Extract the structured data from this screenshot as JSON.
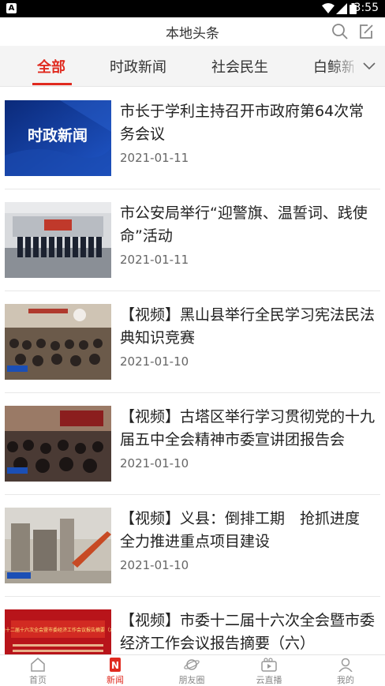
{
  "status": {
    "time": "3:55",
    "app_icon": "A"
  },
  "header": {
    "title": "本地头条",
    "search_icon": "search-icon",
    "edit_icon": "edit-icon"
  },
  "tabs": [
    {
      "label": "全部",
      "active": true
    },
    {
      "label": "时政新闻",
      "active": false
    },
    {
      "label": "社会民生",
      "active": false
    },
    {
      "label": "白鲸新",
      "active": false
    }
  ],
  "thumb_texts": {
    "politics": "时政新闻",
    "report_banner": "市委十二届十六次全会暨市委经济工作会议报告摘要（六）"
  },
  "news": [
    {
      "title": "市长于学利主持召开市政府第64次常务会议",
      "date": "2021-01-11"
    },
    {
      "title": "市公安局举行“迎警旗、温誓词、践使命”活动",
      "date": "2021-01-11"
    },
    {
      "title": "【视频】黑山县举行全民学习宪法民法典知识竞赛",
      "date": "2021-01-10"
    },
    {
      "title": "【视频】古塔区举行学习贯彻党的十九届五中全会精神市委宣讲团报告会",
      "date": "2021-01-10"
    },
    {
      "title": "【视频】义县：倒排工期　抢抓进度　全力推进重点项目建设",
      "date": "2021-01-10"
    },
    {
      "title": "【视频】市委十二届十六次全会暨市委经济工作会议报告摘要（六）",
      "date": ""
    }
  ],
  "bottom_nav": [
    {
      "label": "首页",
      "icon": "home-icon",
      "active": false
    },
    {
      "label": "新闻",
      "icon": "news-icon",
      "active": true
    },
    {
      "label": "朋友圈",
      "icon": "planet-icon",
      "active": false
    },
    {
      "label": "云直播",
      "icon": "live-video-icon",
      "active": false
    },
    {
      "label": "我的",
      "icon": "user-icon",
      "active": false
    }
  ],
  "colors": {
    "accent": "#e02a1f",
    "text": "#222222",
    "date": "#666666"
  }
}
